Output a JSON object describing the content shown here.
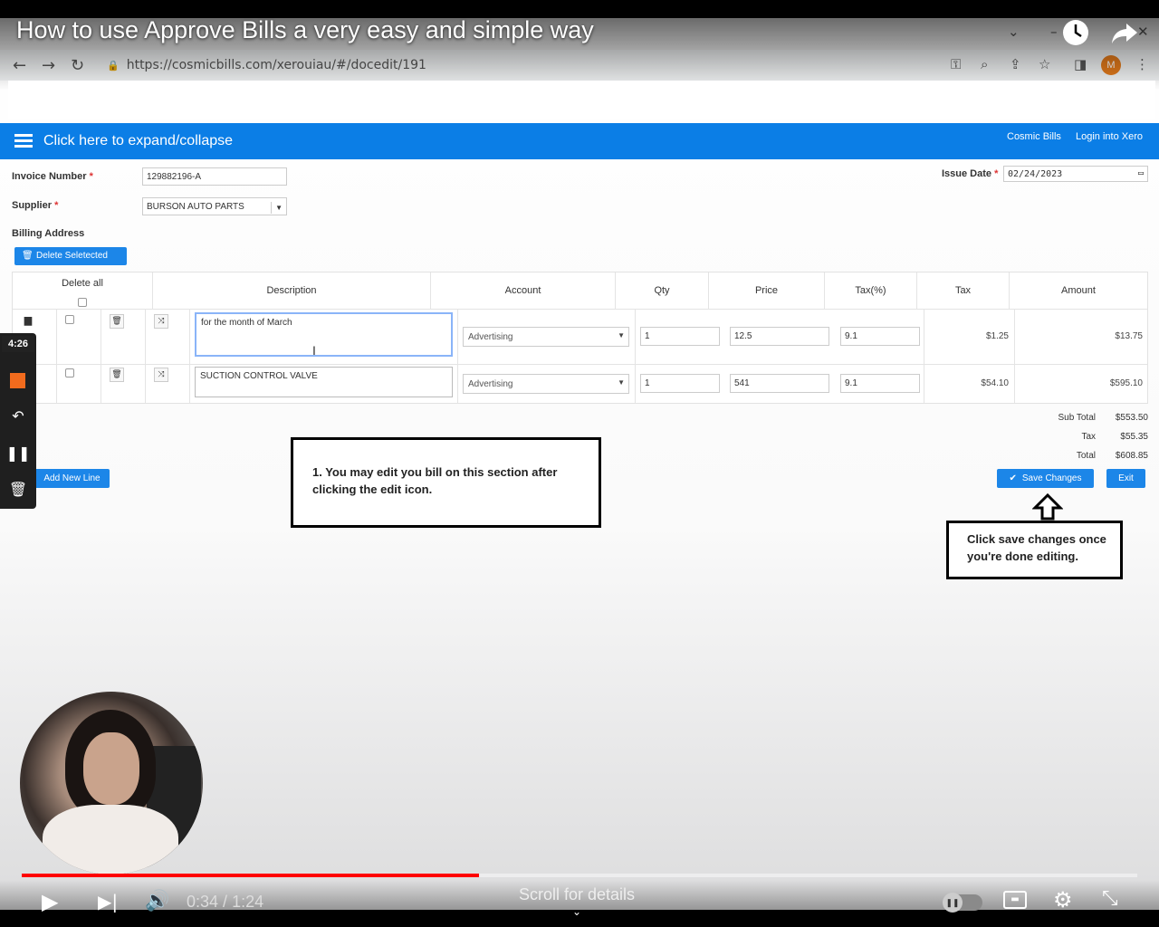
{
  "video": {
    "title": "How to use Approve Bills a very easy and simple way",
    "time_current": "0:34",
    "time_sep": " / ",
    "time_total": "1:24",
    "progress_fraction": 0.41,
    "scroll_hint": "Scroll for details"
  },
  "browser": {
    "url": "https://cosmicbills.com/xerouiau/#/docedit/191",
    "profile_initial": "M"
  },
  "app": {
    "expand_collapse": "Click here to expand/collapse",
    "link_cosmic": "Cosmic Bills",
    "link_login": "Login into Xero",
    "invoice_number_label": "Invoice Number",
    "invoice_number": "129882196-A",
    "supplier_label": "Supplier",
    "supplier": "BURSON AUTO PARTS",
    "issue_date_label": "Issue Date",
    "issue_date": "02/24/2023",
    "billing_address_label": "Billing Address",
    "delete_selected": "Delete Seletected",
    "required_mark": "*",
    "columns": {
      "delete_all": "Delete all",
      "description": "Description",
      "account": "Account",
      "qty": "Qty",
      "price": "Price",
      "tax_pct": "Tax(%)",
      "tax": "Tax",
      "amount": "Amount"
    },
    "lines": [
      {
        "description": "for the month of March",
        "account": "Advertising",
        "qty": "1",
        "price": "12.5",
        "tax_pct": "9.1",
        "tax": "$1.25",
        "amount": "$13.75"
      },
      {
        "description": "SUCTION CONTROL VALVE",
        "account": "Advertising",
        "qty": "1",
        "price": "541",
        "tax_pct": "9.1",
        "tax": "$54.10",
        "amount": "$595.10"
      }
    ],
    "subtotal_label": "Sub Total",
    "subtotal": "$553.50",
    "tax_label": "Tax",
    "tax_total": "$55.35",
    "total_label": "Total",
    "total": "$608.85",
    "add_new_line": "Add New Line",
    "save_changes": "Save Changes",
    "exit": "Exit"
  },
  "annotations": {
    "edit_note": "1. You may edit you bill on this section after clicking the edit icon.",
    "save_note": "Click save changes once you're done editing."
  },
  "recorder": {
    "timer": "4:26"
  },
  "colors": {
    "brand_blue": "#0b7ee6",
    "button_blue": "#1c86e8",
    "progress_red": "#ff0000",
    "record_orange": "#f26b1d"
  }
}
